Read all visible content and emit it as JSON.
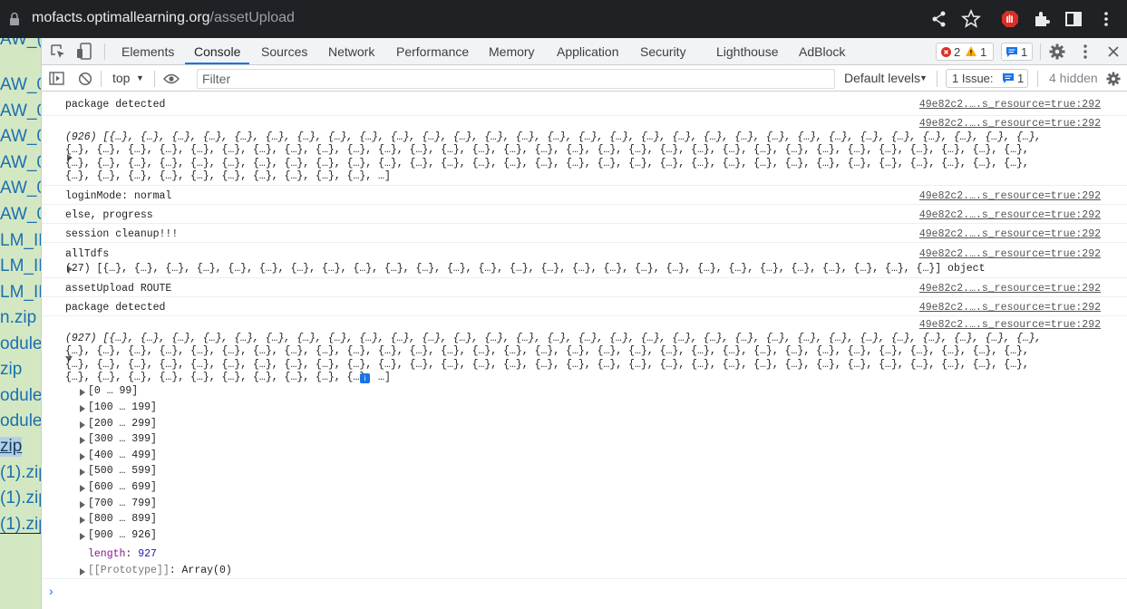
{
  "browser": {
    "url_host": "mofacts.optimallearning.org",
    "url_path": "/assetUpload"
  },
  "page_strip": {
    "items": [
      "AW_(",
      "AW_0",
      "AW_0",
      "AW_0",
      "AW_0",
      "AW_0",
      "AW_0",
      "LM_IN",
      "LM_IN",
      "LM_IN",
      "n.zip",
      "odule",
      "zip",
      "odule",
      "odule",
      "zip",
      "(1).zip",
      "(1).zip",
      "(1).zip"
    ]
  },
  "devtools": {
    "tabs": [
      "Elements",
      "Console",
      "Sources",
      "Network",
      "Performance",
      "Memory",
      "Application",
      "Security",
      "Lighthouse",
      "AdBlock"
    ],
    "error_count": "2",
    "warning_count": "1",
    "message_count": "1",
    "toolbar": {
      "context": "top",
      "filter_placeholder": "Filter",
      "levels": "Default levels",
      "issues_label": "1 Issue:",
      "issues_count": "1",
      "hidden": "4 hidden"
    }
  },
  "console": {
    "source": "49e82c2.….s_resource=true:292",
    "messages": [
      {
        "text": "package detected"
      },
      {
        "lines": [
          "(926) [{…}, {…}, {…}, {…}, {…}, {…}, {…}, {…}, {…}, {…}, {…}, {…}, {…}, {…}, {…}, {…}, {…}, {…}, {…}, {…}, {…}, {…}, {…}, {…}, {…}, {…}, {…}, {…}, {…}, {…},",
          "{…}, {…}, {…}, {…}, {…}, {…}, {…}, {…}, {…}, {…}, {…}, {…}, {…}, {…}, {…}, {…}, {…}, {…}, {…}, {…}, {…}, {…}, {…}, {…}, {…}, {…}, {…}, {…}, {…}, {…}, {…},",
          "{…}, {…}, {…}, {…}, {…}, {…}, {…}, {…}, {…}, {…}, {…}, {…}, {…}, {…}, {…}, {…}, {…}, {…}, {…}, {…}, {…}, {…}, {…}, {…}, {…}, {…}, {…}, {…}, {…}, {…}, {…},",
          "{…}, {…}, {…}, {…}, {…}, {…}, {…}, {…}, {…}, {…}, …]"
        ]
      },
      {
        "text": "loginMode: normal"
      },
      {
        "text": "else, progress"
      },
      {
        "text": "session cleanup!!!"
      },
      {
        "text": "allTdfs",
        "sub": "(27) [{…}, {…}, {…}, {…}, {…}, {…}, {…}, {…}, {…}, {…}, {…}, {…}, {…}, {…}, {…}, {…}, {…}, {…}, {…}, {…}, {…}, {…}, {…}, {…}, {…}, {…}, {…}] object"
      },
      {
        "text": "assetUpload ROUTE"
      },
      {
        "text": "package detected"
      },
      {
        "lines": [
          "(927) [{…}, {…}, {…}, {…}, {…}, {…}, {…}, {…}, {…}, {…}, {…}, {…}, {…}, {…}, {…}, {…}, {…}, {…}, {…}, {…}, {…}, {…}, {…}, {…}, {…}, {…}, {…}, {…}, {…}, {…},",
          "{…}, {…}, {…}, {…}, {…}, {…}, {…}, {…}, {…}, {…}, {…}, {…}, {…}, {…}, {…}, {…}, {…}, {…}, {…}, {…}, {…}, {…}, {…}, {…}, {…}, {…}, {…}, {…}, {…}, {…}, {…},",
          "{…}, {…}, {…}, {…}, {…}, {…}, {…}, {…}, {…}, {…}, {…}, {…}, {…}, {…}, {…}, {…}, {…}, {…}, {…}, {…}, {…}, {…}, {…}, {…}, {…}, {…}, {…}, {…}, {…}, {…}, {…},",
          "{…}, {…}, {…}, {…}, {…}, {…}, {…}, {…}, {…}, {…}, …]"
        ],
        "info": "i"
      }
    ],
    "chunks": [
      "[0 … 99]",
      "[100 … 199]",
      "[200 … 299]",
      "[300 … 399]",
      "[400 … 499]",
      "[500 … 599]",
      "[600 … 699]",
      "[700 … 799]",
      "[800 … 899]",
      "[900 … 926]"
    ],
    "length_key": "length",
    "length_value": "927",
    "prototype_key": "[[Prototype]]",
    "prototype_value": "Array(0)",
    "prompt": "›"
  }
}
